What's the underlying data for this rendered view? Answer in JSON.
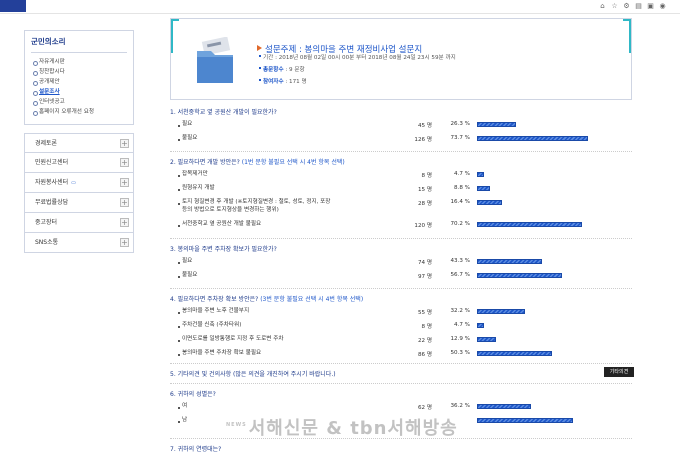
{
  "sidebar": {
    "title": "군민의소리",
    "subitems": [
      {
        "label": "자유게시판",
        "active": false
      },
      {
        "label": "칭찬합시다",
        "active": false
      },
      {
        "label": "공개제안",
        "active": false
      },
      {
        "label": "설문조사",
        "active": true
      },
      {
        "label": "인터넷공고",
        "active": false
      },
      {
        "label": "홈페이지 오류개선 요청",
        "active": false
      }
    ],
    "menu": [
      {
        "label": "경제토론"
      },
      {
        "label": "민원신고센터"
      },
      {
        "label": "자원봉사센터"
      },
      {
        "label": "무료법률상담"
      },
      {
        "label": "중고장터"
      },
      {
        "label": "SNS소통"
      }
    ]
  },
  "survey": {
    "title": "설문주제 : 봉의마을 주변 재정비사업 설문지",
    "period": "기간 : 2018년 08월 02일 00시 00분 부터 2018년 08월 24일 23시 59분 까지",
    "total_label": "총문항수",
    "total_value": " : 9 문항",
    "participants_label": "참여자수",
    "participants_value": " : 171 명"
  },
  "questions": [
    {
      "title": "1. 서천중학교 옆 공원산 개발이 필요한가?",
      "hint": "",
      "options": [
        {
          "label": "필요",
          "count": "45 명",
          "pct": "26.3 %",
          "value": 26.3
        },
        {
          "label": "불필요",
          "count": "126 명",
          "pct": "73.7 %",
          "value": 73.7
        }
      ]
    },
    {
      "title": "2. 필요하다면 개발 방안은?",
      "hint": "(1번 문항 불필요 선택 시 4번 항목 선택)",
      "options": [
        {
          "label": "잡목제거만",
          "count": "8 명",
          "pct": "4.7 %",
          "value": 4.7
        },
        {
          "label": "원형유지 개발",
          "count": "15 명",
          "pct": "8.8 %",
          "value": 8.8
        },
        {
          "label": "토지 형질변경 후 개발 (※토지형질변경 : 절토, 성토, 정지, 포장 등의 방법으로 토지형상을 변경하는 행위)",
          "count": "28 명",
          "pct": "16.4 %",
          "value": 16.4
        },
        {
          "label": "서천중학교 옆 공원산 개발 불필요",
          "count": "120 명",
          "pct": "70.2 %",
          "value": 70.2
        }
      ]
    },
    {
      "title": "3. 봉의마을 주변 주차장 확보가 필요한가?",
      "hint": "",
      "options": [
        {
          "label": "필요",
          "count": "74 명",
          "pct": "43.3 %",
          "value": 43.3
        },
        {
          "label": "불필요",
          "count": "97 명",
          "pct": "56.7 %",
          "value": 56.7
        }
      ]
    },
    {
      "title": "4. 필요하다면 주차장 확보 방안은?",
      "hint": "(3번 문항 불필요 선택 시 4번 항목 선택)",
      "options": [
        {
          "label": "봉의마을 주변 노후 건물부지",
          "count": "55 명",
          "pct": "32.2 %",
          "value": 32.2
        },
        {
          "label": "주차건물 신축 (주차타워)",
          "count": "8 명",
          "pct": "4.7 %",
          "value": 4.7
        },
        {
          "label": "이면도로를 일방통행로 지정 후 도로변 주차",
          "count": "22 명",
          "pct": "12.9 %",
          "value": 12.9
        },
        {
          "label": "봉의마을 주변 주차장 확보 불필요",
          "count": "86 명",
          "pct": "50.3 %",
          "value": 50.3
        }
      ]
    },
    {
      "title": "5. 기타의견 및 건의사항 (많은 의견을 개진하여 주시기 바랍니다.)",
      "hint": "",
      "button": "기타의견",
      "options": []
    },
    {
      "title": "6. 귀하의 성별은?",
      "hint": "",
      "options": [
        {
          "label": "여",
          "count": "62 명",
          "pct": "36.2 %",
          "value": 36.2
        },
        {
          "label": "남",
          "count": "",
          "pct": "",
          "value": 63.8
        }
      ]
    },
    {
      "title": "7. 귀하의 연령대는?",
      "hint": "",
      "options": []
    }
  ],
  "watermark": {
    "news": "NEWS",
    "text": "서해신문 & tbn서해방송"
  }
}
